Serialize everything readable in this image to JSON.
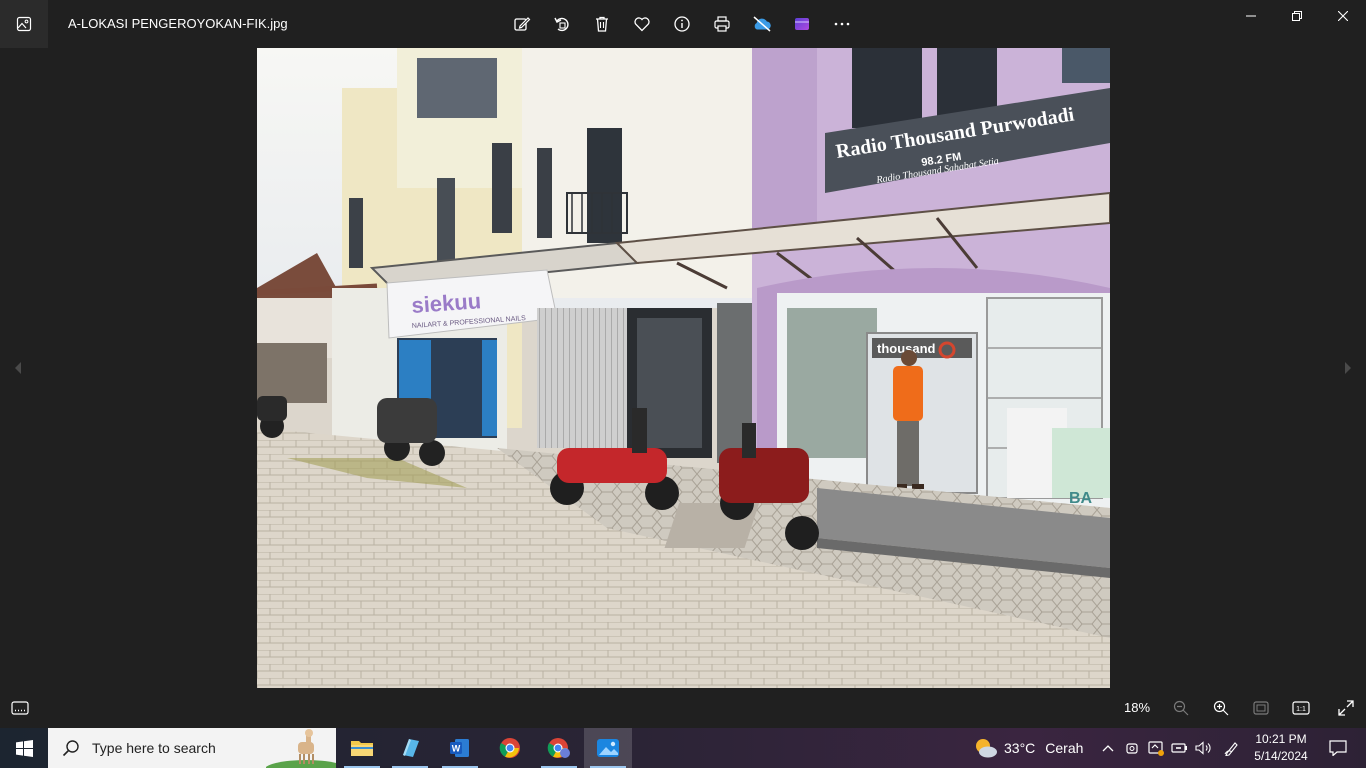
{
  "window": {
    "file_name": "A-LOKASI PENGEROYOKAN-FIK.jpg"
  },
  "toolbar": {
    "items": [
      "edit-image",
      "rotate",
      "delete",
      "favorite",
      "file-info",
      "print",
      "onedrive-sync",
      "clipchamp",
      "see-more"
    ]
  },
  "photo": {
    "sign_left": "siekuu",
    "sign_left_sub": "NAILART & PROFESSIONAL NAILS",
    "sign_right": "Radio Thousand Purwodadi",
    "sign_right_freq": "98.2 FM",
    "sign_right_sub": "Radio Thousand Sahabat Setia",
    "door_sign": "thousand",
    "banner_text": "BA"
  },
  "statusbar": {
    "zoom": "18%",
    "actual_size_label": "1:1"
  },
  "taskbar": {
    "search_placeholder": "Type here to search",
    "weather_temp": "33°C",
    "weather_desc": "Cerah",
    "time": "10:21 PM",
    "date": "5/14/2024",
    "active_app": "photos"
  },
  "colors": {
    "background": "#202020",
    "accent": "#9cc6ee"
  }
}
